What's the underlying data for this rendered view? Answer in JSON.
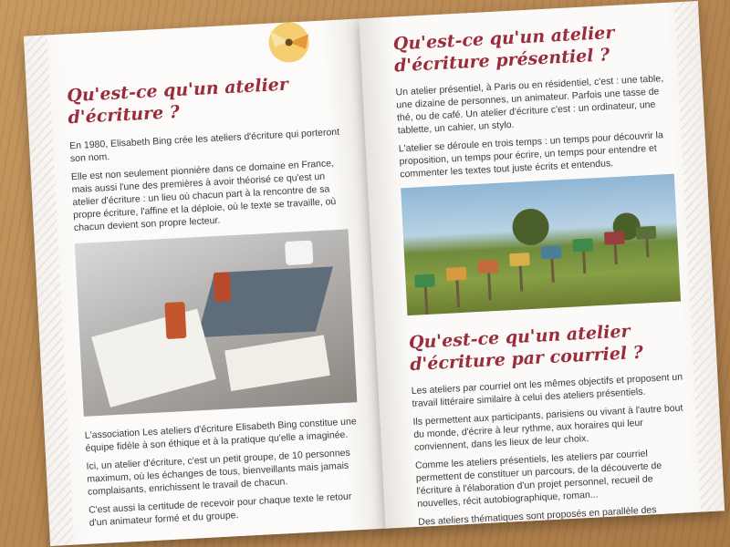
{
  "left_page": {
    "title": "Qu'est-ce qu'un atelier d'écriture ?",
    "paragraphs": [
      "En 1980, Elisabeth Bing crée les ateliers d'écriture qui porteront son nom.",
      "Elle est non seulement pionnière dans ce domaine en France, mais aussi l'une des premières à avoir théorisé ce qu'est un atelier d'écriture : un lieu où chacun part à la rencontre de sa propre écriture, l'affine et la déploie, où le texte se travaille, où chacun devient son propre lecteur.",
      "L'association Les ateliers d'écriture Elisabeth Bing constitue une équipe fidèle à son éthique et à la pratique qu'elle a imaginée.",
      "Ici, un atelier d'écriture, c'est un petit groupe, de 10 personnes maximum, où les échanges de tous, bienveillants mais jamais complaisants, enrichissent le travail de chacun.",
      "C'est aussi la certitude de recevoir pour chaque texte le retour d'un animateur formé et du groupe."
    ]
  },
  "right_page": {
    "title1": "Qu'est-ce qu'un atelier d'écriture présentiel ?",
    "paragraphs1": [
      "Un atelier présentiel, à Paris ou en résidentiel, c'est : une table, une dizaine de personnes, un animateur. Parfois une tasse de thé, ou de café. Un atelier d'écriture c'est : un ordinateur, une tablette, un cahier, un stylo.",
      "L'atelier se déroule en trois temps : un temps pour découvrir la proposition, un temps pour écrire, un temps pour entendre et commenter les textes tout juste écrits et entendus."
    ],
    "title2": "Qu'est-ce qu'un atelier d'écriture par courriel ?",
    "paragraphs2": [
      "Les ateliers par courriel ont les mêmes objectifs et proposent un travail littéraire similaire à celui des ateliers présentiels.",
      "Ils permettent aux participants, parisiens ou vivant à l'autre bout du monde, d'écrire à leur rythme, aux horaires qui leur conviennent, dans les lieux de leur choix.",
      "Comme les ateliers présentiels, les ateliers par courriel permettent de constituer un parcours, de la découverte de l'écriture à l'élaboration d'un projet personnel, recueil de nouvelles, récit autobiographique, roman...",
      "Des ateliers thématiques sont proposés en parallèle des parcours."
    ]
  },
  "colors": {
    "title": "#9a2c3c",
    "text": "#3a3a3a",
    "table": "#b98a55"
  }
}
